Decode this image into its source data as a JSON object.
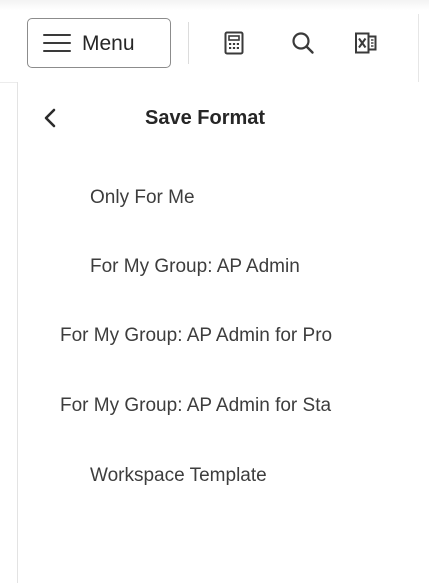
{
  "toolbar": {
    "menu_label": "Menu",
    "icons": [
      "hamburger-icon",
      "calculator-icon",
      "search-icon",
      "excel-export-icon"
    ]
  },
  "panel": {
    "title": "Save Format",
    "back_icon": "chevron-left-icon",
    "options": [
      {
        "label": "Only For Me"
      },
      {
        "label": "For My Group: AP Admin"
      },
      {
        "label": "For My Group: AP Admin for Pro"
      },
      {
        "label": "For My Group: AP Admin for Sta"
      },
      {
        "label": "Workspace Template"
      }
    ]
  },
  "colors": {
    "text": "#3d3d3d",
    "title": "#262626",
    "border": "#8c8c8c"
  }
}
